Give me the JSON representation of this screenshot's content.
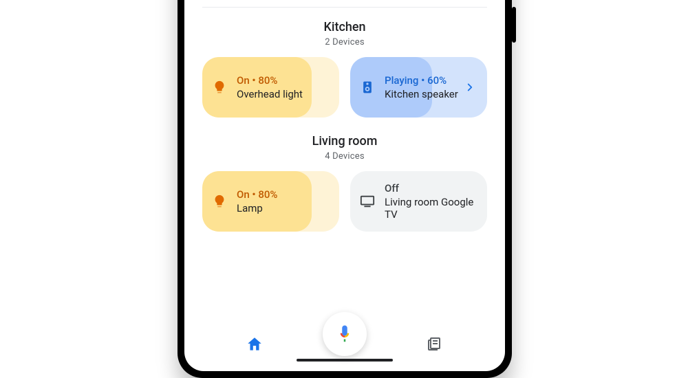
{
  "rooms": [
    {
      "title": "Kitchen",
      "subtitle": "2 Devices",
      "devices": [
        {
          "kind": "light",
          "status": "On • 80%",
          "name": "Overhead light",
          "pill_pct": 80,
          "chevron": false
        },
        {
          "kind": "speaker",
          "status": "Playing • 60%",
          "name": "Kitchen speaker",
          "pill_pct": 60,
          "chevron": true
        }
      ]
    },
    {
      "title": "Living room",
      "subtitle": "4 Devices",
      "devices": [
        {
          "kind": "light",
          "status": "On • 80%",
          "name": "Lamp",
          "pill_pct": 80,
          "chevron": false
        },
        {
          "kind": "off",
          "status": "Off",
          "name": "Living room Google TV",
          "pill_pct": 0,
          "chevron": false
        }
      ]
    }
  ]
}
